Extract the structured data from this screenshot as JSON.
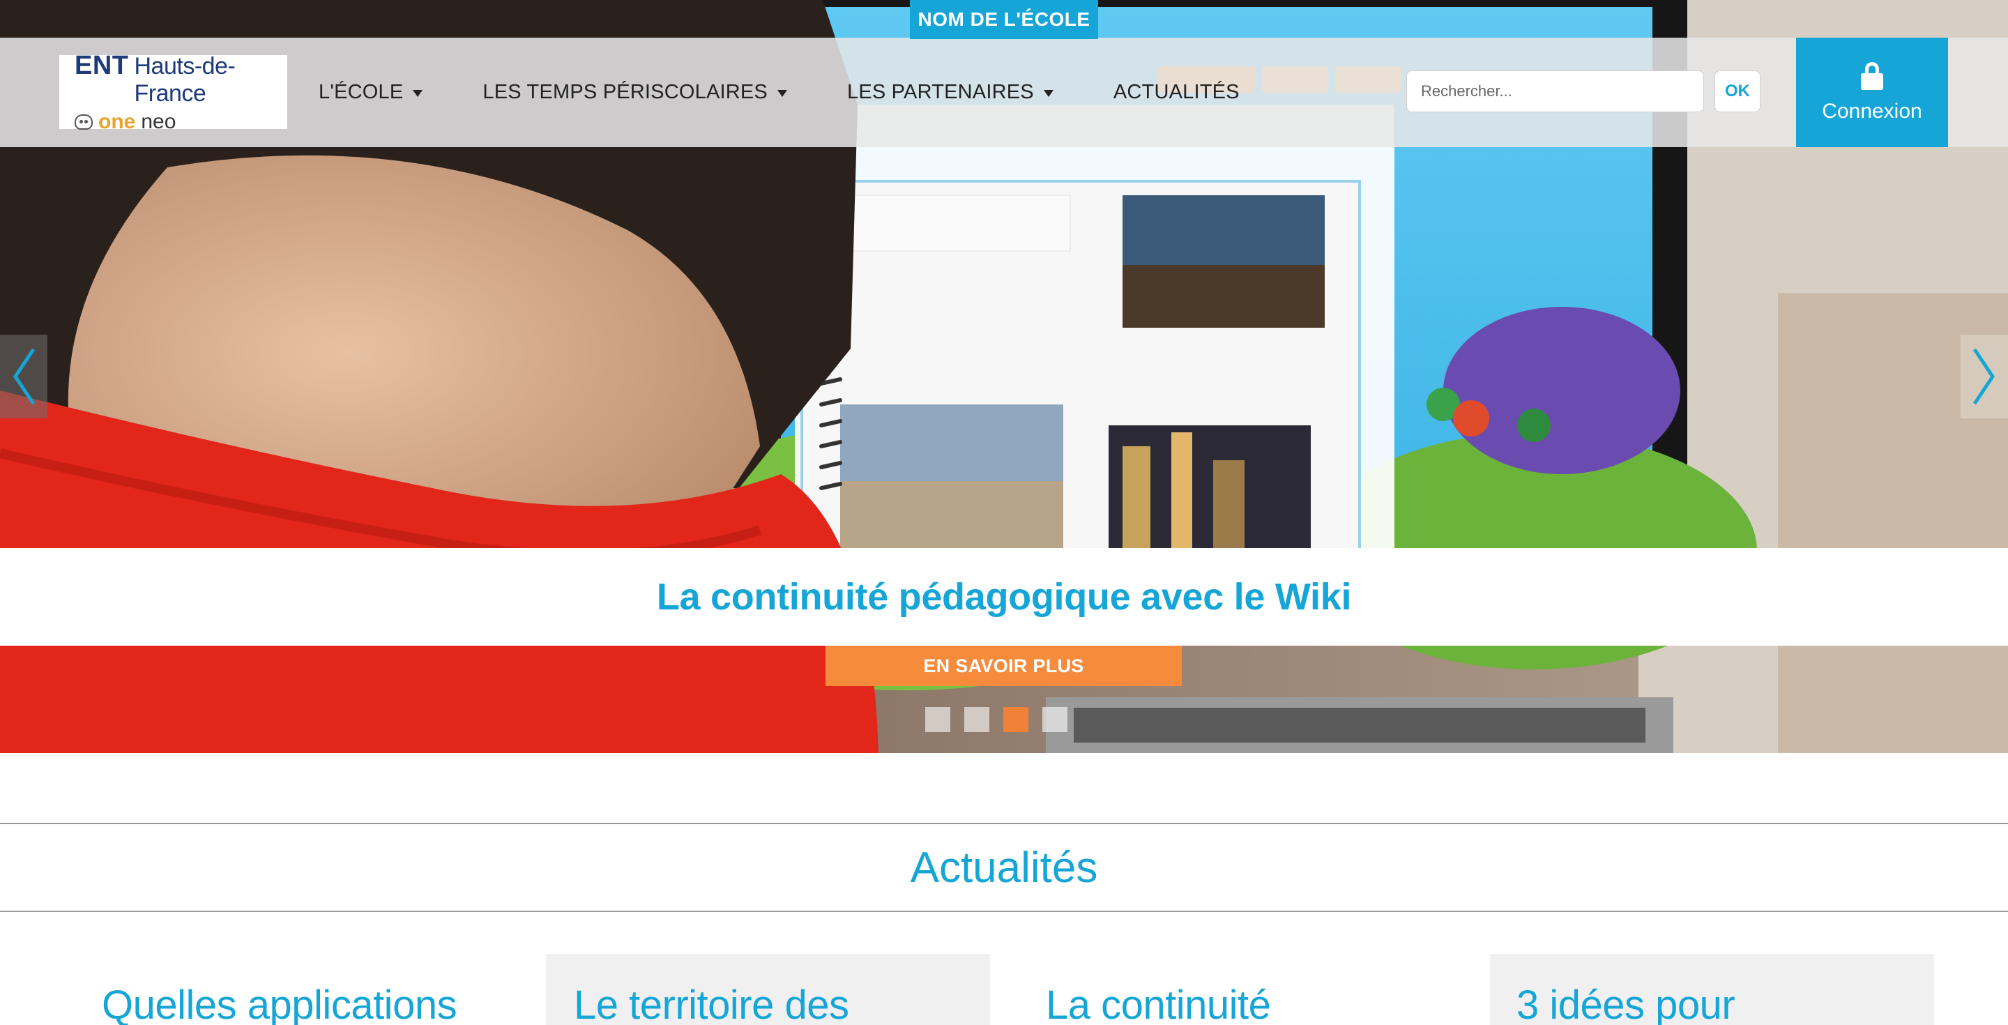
{
  "header": {
    "school_name": "NOM DE L'ÉCOLE",
    "logo": {
      "ent": "ENT",
      "region": "Hauts-de-France",
      "one": "one",
      "neo": "neo"
    },
    "nav": [
      {
        "label": "L'ÉCOLE",
        "has_dropdown": true
      },
      {
        "label": "LES TEMPS PÉRISCOLAIRES",
        "has_dropdown": true
      },
      {
        "label": "LES PARTENAIRES",
        "has_dropdown": true
      },
      {
        "label": "ACTUALITÉS",
        "has_dropdown": false
      }
    ],
    "search": {
      "placeholder": "Rechercher...",
      "submit_label": "OK"
    },
    "login": {
      "label": "Connexion",
      "icon": "lock-icon"
    }
  },
  "hero": {
    "caption": "La continuité pédagogique avec le Wiki",
    "button_label": "EN SAVOIR PLUS",
    "slide_count": 4,
    "active_slide": 3
  },
  "news": {
    "title": "Actualités",
    "cards": [
      {
        "title": "Quelles applications"
      },
      {
        "title": "Le territoire des"
      },
      {
        "title": "La continuité"
      },
      {
        "title": "3 idées pour"
      }
    ]
  },
  "colors": {
    "brand_blue": "#15a5d6",
    "accent_orange": "#f58b3b",
    "active_dot": "#f08238",
    "navy": "#1e3a78"
  }
}
